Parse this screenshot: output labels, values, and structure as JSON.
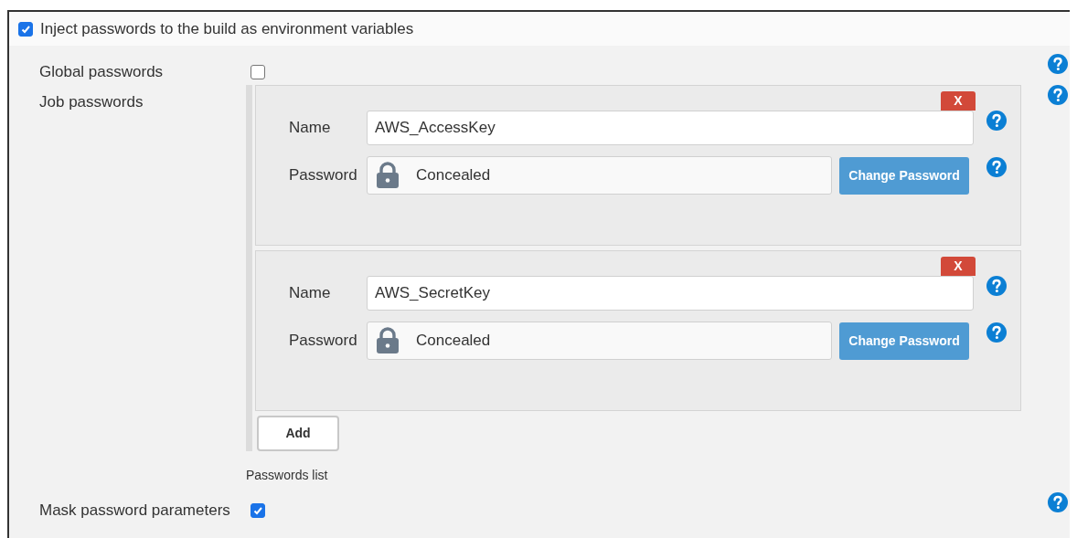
{
  "inject": {
    "label": "Inject passwords to the build as environment variables",
    "checked": true
  },
  "settings": [
    {
      "kind": "checkbox",
      "label": "Global passwords",
      "checked": false
    },
    {
      "kind": "list",
      "label": "Job passwords",
      "entries": [
        {
          "delete_button": "X",
          "name_label": "Name",
          "name": "AWS_AccessKey",
          "password_label": "Password",
          "password": "Concealed",
          "change_button": "Change Password"
        },
        {
          "delete_button": "X",
          "name_label": "Name",
          "name": "AWS_SecretKey",
          "password_label": "Password",
          "password": "Concealed",
          "change_button": "Change Password"
        }
      ],
      "add_button": "Add",
      "caption": "Passwords list"
    },
    {
      "kind": "checkbox",
      "label": "Mask password parameters",
      "checked": true
    }
  ]
}
